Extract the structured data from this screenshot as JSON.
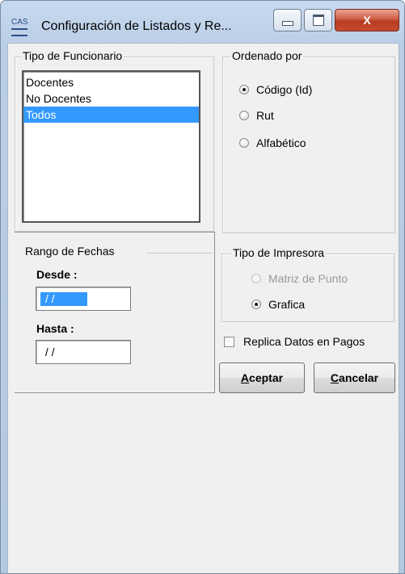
{
  "window": {
    "app_icon_text": "CAS",
    "title": "Configuración de Listados y Re...",
    "close_glyph": "X"
  },
  "tipo_funcionario": {
    "legend": "Tipo de Funcionario",
    "items": [
      {
        "label": "Docentes",
        "selected": false
      },
      {
        "label": "No Docentes",
        "selected": false
      },
      {
        "label": "Todos",
        "selected": true
      }
    ]
  },
  "ordenado_por": {
    "legend": "Ordenado por",
    "options": [
      {
        "label": "Código (Id)",
        "checked": true
      },
      {
        "label": "Rut",
        "checked": false
      },
      {
        "label": "Alfabético",
        "checked": false
      }
    ]
  },
  "rango_fechas": {
    "legend": "Rango de Fechas",
    "desde_label": "Desde :",
    "desde_value": " / /",
    "hasta_label": "Hasta :",
    "hasta_value": " / /"
  },
  "tipo_impresora": {
    "legend": "Tipo de Impresora",
    "options": [
      {
        "label": "Matriz de Punto",
        "checked": false,
        "disabled": true
      },
      {
        "label": "Grafica",
        "checked": true,
        "disabled": false
      }
    ]
  },
  "replica": {
    "label": "Replica Datos en Pagos",
    "checked": false
  },
  "buttons": {
    "aceptar_mnemonic": "A",
    "aceptar_rest": "ceptar",
    "cancelar_mnemonic": "C",
    "cancelar_rest": "ancelar"
  }
}
